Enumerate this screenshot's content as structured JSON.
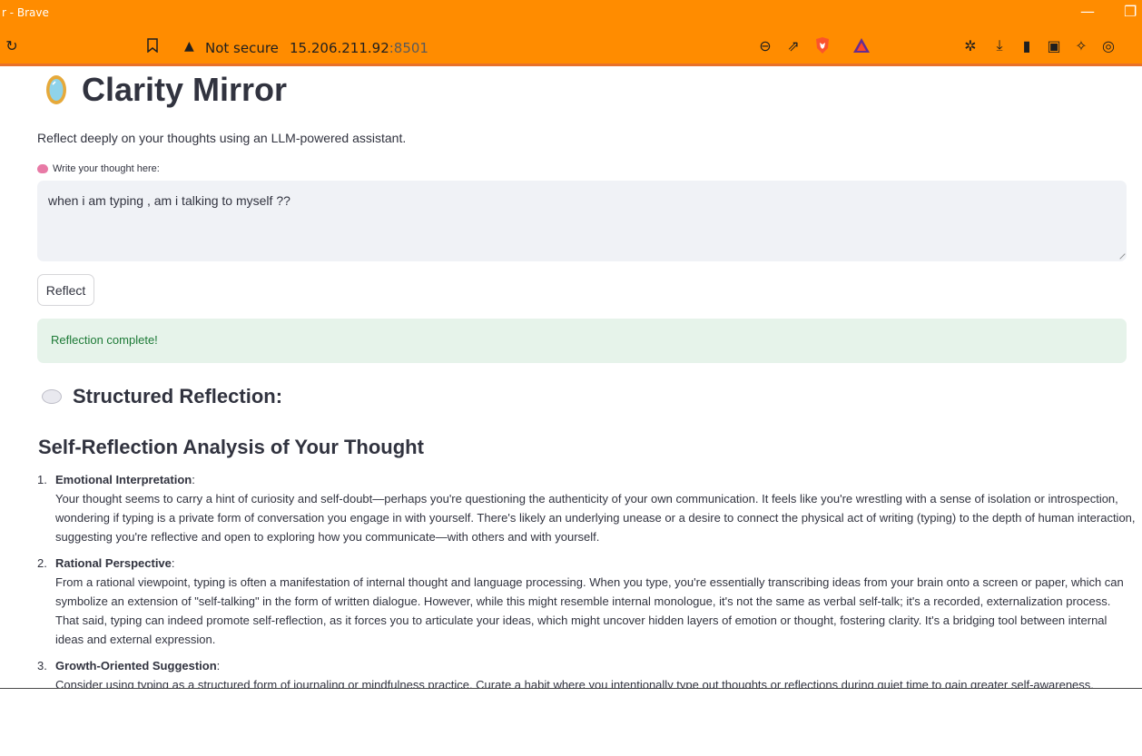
{
  "browser": {
    "window_title": "r - Brave",
    "security_label": "Not secure",
    "url_host": "15.206.211.92",
    "url_port": ":8501"
  },
  "app": {
    "title": "Clarity Mirror",
    "subtitle": "Reflect deeply on your thoughts using an LLM-powered assistant.",
    "input_label": "Write your thought here:",
    "input_value": "when i am typing , am i talking to myself ??",
    "button_label": "Reflect",
    "success_message": "Reflection complete!",
    "section_title": "Structured Reflection:",
    "analysis_title": "Self-Reflection Analysis of Your Thought",
    "items": [
      {
        "number": "1.",
        "title": "Emotional Interpretation",
        "body": "Your thought seems to carry a hint of curiosity and self-doubt—perhaps you're questioning the authenticity of your own communication. It feels like you're wrestling with a sense of isolation or introspection, wondering if typing is a private form of conversation you engage in with yourself. There's likely an underlying unease or a desire to connect the physical act of writing (typing) to the depth of human interaction, suggesting you're reflective and open to exploring how you communicate—with others and with yourself."
      },
      {
        "number": "2.",
        "title": "Rational Perspective",
        "body": "From a rational viewpoint, typing is often a manifestation of internal thought and language processing. When you type, you're essentially transcribing ideas from your brain onto a screen or paper, which can symbolize an extension of \"self-talking\" in the form of written dialogue. However, while this might resemble internal monologue, it's not the same as verbal self-talk; it's a recorded, externalization process. That said, typing can indeed promote self-reflection, as it forces you to articulate your ideas, which might uncover hidden layers of emotion or thought, fostering clarity. It's a bridging tool between internal ideas and external expression."
      },
      {
        "number": "3.",
        "title": "Growth-Oriented Suggestion",
        "body": "Consider using typing as a structured form of journaling or mindfulness practice. Curate a habit where you intentionally type out thoughts or reflections during quiet time to gain greater self-awareness."
      }
    ]
  }
}
